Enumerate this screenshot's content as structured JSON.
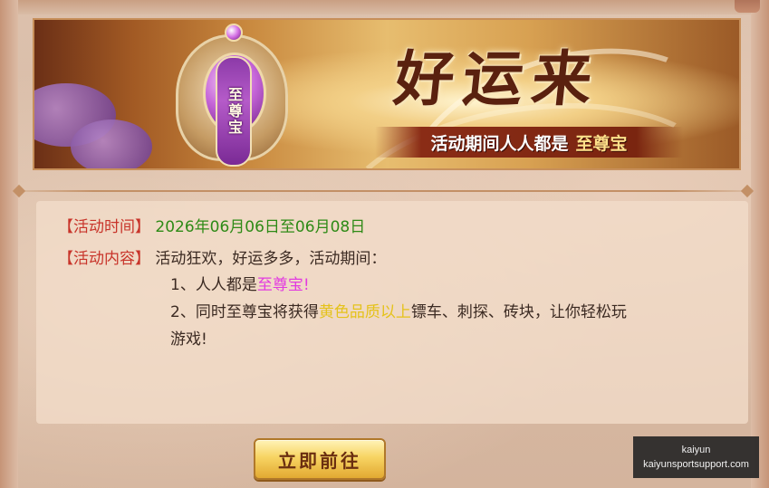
{
  "banner": {
    "title": "好运来",
    "subtitle_main": "活动期间人人都是",
    "subtitle_accent": "至尊宝",
    "emblem_text": "至尊宝"
  },
  "details": {
    "time_label": "【活动时间】",
    "time_value": "2026年06月06日至06月08日",
    "content_label": "【活动内容】",
    "intro": "活动狂欢，好运多多，活动期间：",
    "item1_prefix": "1、人人都是",
    "item1_highlight": "至尊宝!",
    "item2_prefix": "2、同时至尊宝将获得",
    "item2_highlight": "黄色品质以上",
    "item2_suffix": "镖车、刺探、砖块，让你轻松玩",
    "item2_continuation": "游戏!"
  },
  "action": {
    "go_label": "立即前往"
  },
  "watermark": {
    "line1": "kaiyun",
    "line2": "kaiyunsportsupport.com"
  },
  "colors": {
    "label": "#c8342a",
    "date": "#2e8a16",
    "highlight_pink": "#e23be0",
    "highlight_yellow": "#e5c21a"
  }
}
